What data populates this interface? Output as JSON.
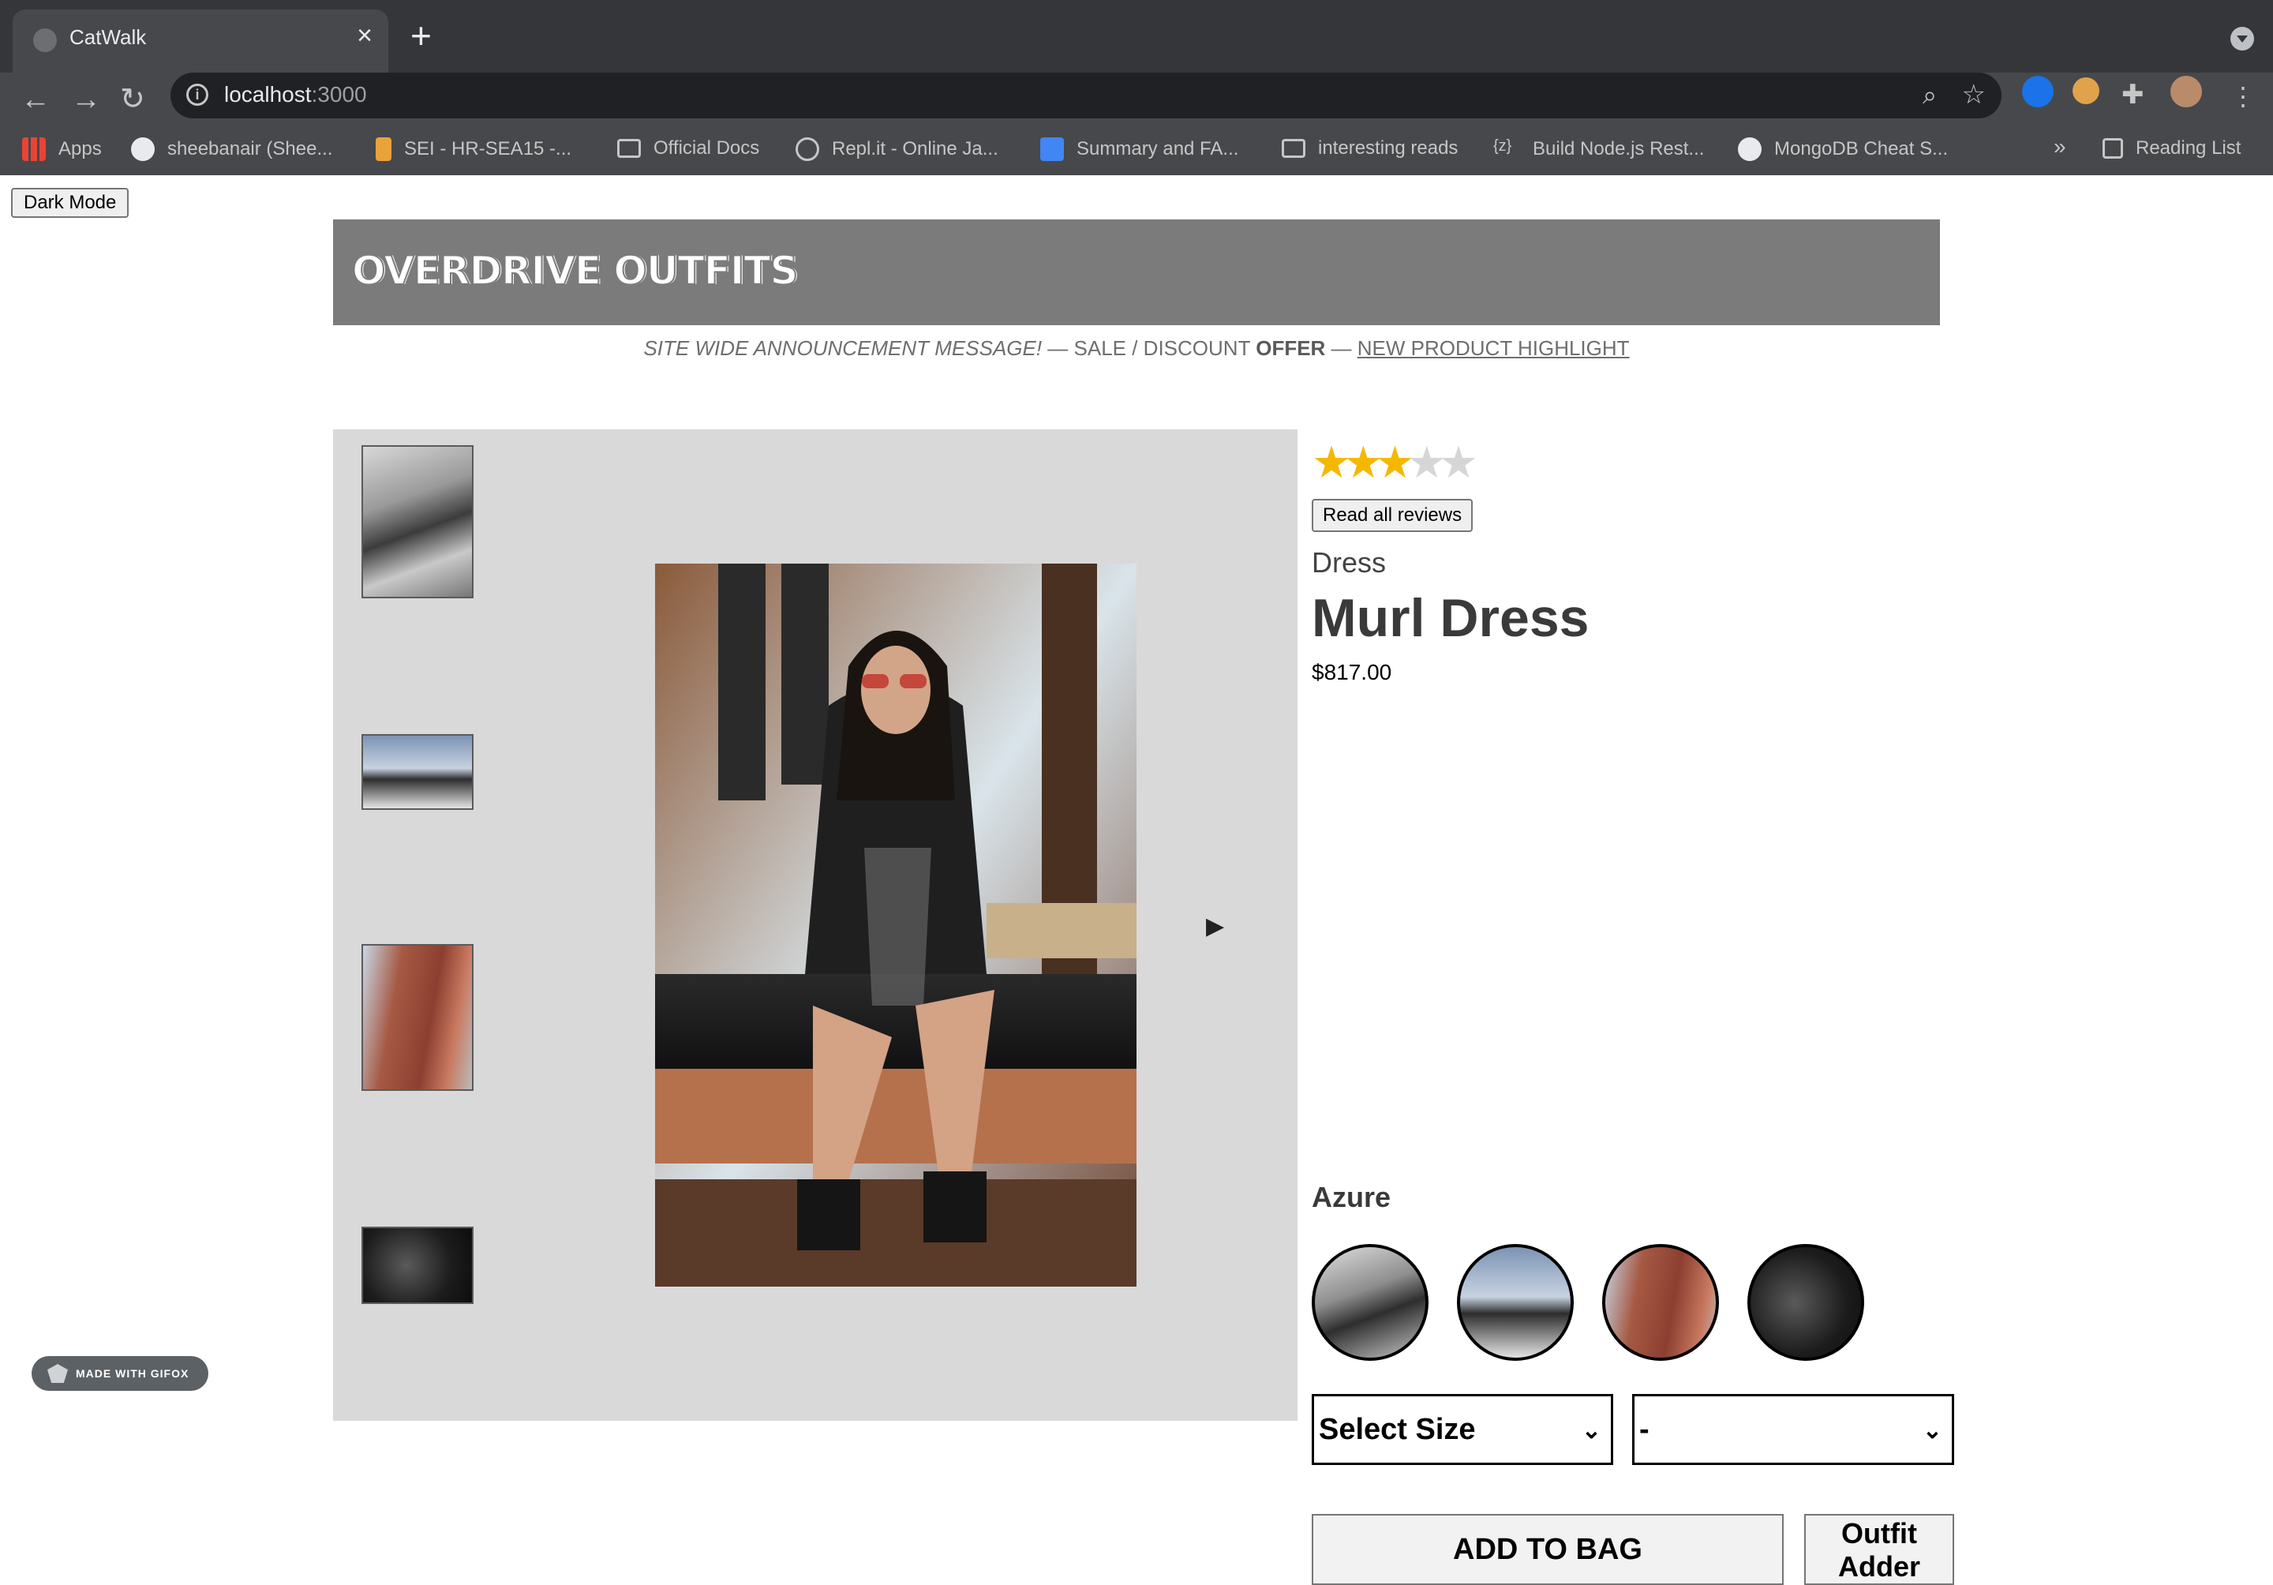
{
  "browser": {
    "tab_title": "CatWalk",
    "tab_close": "×",
    "new_tab": "+",
    "url_host": "localhost",
    "url_port": ":3000",
    "bookmarks": [
      {
        "label": "Apps",
        "icon": "apps-grid-icon"
      },
      {
        "label": "sheebanair (Shee...",
        "icon": "github-icon"
      },
      {
        "label": "SEI - HR-SEA15 -...",
        "icon": "hand-icon"
      },
      {
        "label": "Official Docs",
        "icon": "folder-icon"
      },
      {
        "label": "Repl.it - Online Ja...",
        "icon": "replit-icon"
      },
      {
        "label": "Summary and FA...",
        "icon": "doc-icon"
      },
      {
        "label": "interesting reads",
        "icon": "folder-icon"
      },
      {
        "label": "Build Node.js Rest...",
        "icon": "braces-icon"
      },
      {
        "label": "MongoDB Cheat S...",
        "icon": "github-icon"
      }
    ],
    "overflow": "»",
    "reading_list": "Reading List"
  },
  "page": {
    "dark_mode_label": "Dark Mode",
    "brand": "OVERDRIVE OUTFITS",
    "announcement": {
      "message": "SITE WIDE ANNOUNCEMENT MESSAGE!",
      "sep1": " — SALE / DISCOUNT ",
      "offer": "OFFER",
      "sep2": " — ",
      "highlight": "NEW PRODUCT HIGHLIGHT"
    }
  },
  "product": {
    "rating": 3,
    "rating_max": 5,
    "star_color": "#f5b800",
    "star_empty_color": "#d6d6d6",
    "read_reviews_label": "Read all reviews",
    "category": "Dress",
    "name": "Murl Dress",
    "price": "$817.00",
    "style_name": "Azure",
    "size_select": "Select Size",
    "qty_select": "-",
    "add_to_bag": "ADD TO BAG",
    "outfit_adder_line1": "Outfit",
    "outfit_adder_line2": "Adder"
  },
  "gallery": {
    "next_arrow": "▶",
    "thumbnail_count": 4
  },
  "watermark": "MADE WITH GIFOX"
}
